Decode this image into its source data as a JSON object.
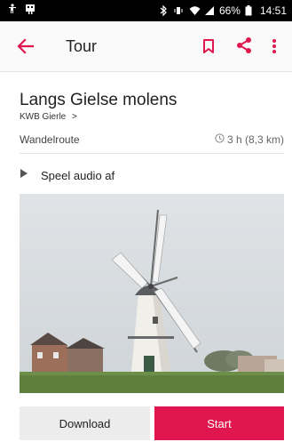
{
  "status_bar": {
    "battery": "66%",
    "time": "14:51"
  },
  "app_bar": {
    "title": "Tour",
    "accent_color": "#e0174e"
  },
  "tour": {
    "title": "Langs Gielse molens",
    "organization": "KWB Gierle",
    "organization_chevron": ">",
    "type": "Wandelroute",
    "duration": "3 h (8,3 km)"
  },
  "audio": {
    "label": "Speel audio af"
  },
  "photo": {
    "subject": "windmill"
  },
  "buttons": {
    "download": "Download",
    "start": "Start"
  }
}
